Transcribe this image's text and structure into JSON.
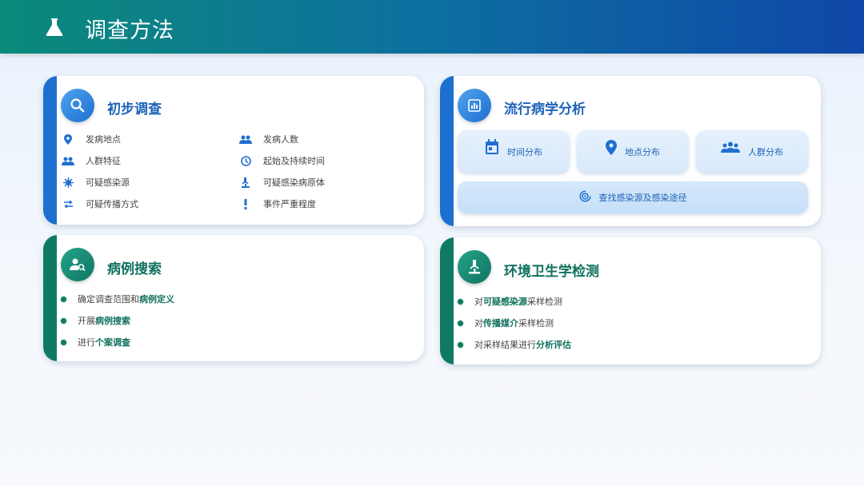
{
  "header": {
    "title": "调查方法",
    "icon": "flask-icon"
  },
  "cards": {
    "initial": {
      "title": "初步调查",
      "icon": "search-icon",
      "items": [
        {
          "label": "发病地点",
          "icon": "location-pin-icon"
        },
        {
          "label": "发病人数",
          "icon": "people-icon"
        },
        {
          "label": "人群特征",
          "icon": "people-icon"
        },
        {
          "label": "起始及持续时间",
          "icon": "clock-icon"
        },
        {
          "label": "可疑感染源",
          "icon": "virus-icon"
        },
        {
          "label": "可疑感染病原体",
          "icon": "microscope-icon"
        },
        {
          "label": "可疑传播方式",
          "icon": "swap-arrows-icon"
        },
        {
          "label": "事件严重程度",
          "icon": "exclamation-icon"
        }
      ]
    },
    "epi": {
      "title": "流行病学分析",
      "icon": "analytics-icon",
      "tiles": [
        {
          "label": "时间分布",
          "icon": "calendar-icon"
        },
        {
          "label": "地点分布",
          "icon": "location-pin-icon"
        },
        {
          "label": "人群分布",
          "icon": "group-icon"
        }
      ],
      "wide": {
        "label": "查找感染源及感染途径",
        "icon": "target-icon"
      }
    },
    "case": {
      "title": "病例搜索",
      "icon": "person-search-icon",
      "bullets": [
        {
          "pre": "确定调查范围和",
          "hl": "病例定义",
          "post": ""
        },
        {
          "pre": "开展",
          "hl": "病例搜索",
          "post": ""
        },
        {
          "pre": "进行",
          "hl": "个案调查",
          "post": ""
        }
      ]
    },
    "env": {
      "title": "环境卫生学检测",
      "icon": "microscope-icon",
      "bullets": [
        {
          "pre": "对",
          "hl": "可疑感染源",
          "post": "采样检测"
        },
        {
          "pre": "对",
          "hl": "传播媒介",
          "post": "采样检测"
        },
        {
          "pre": "对采样结果进行",
          "hl": "分析评估",
          "post": ""
        }
      ]
    }
  },
  "colors": {
    "blue": "#1d70cf",
    "teal": "#0f7a63"
  }
}
